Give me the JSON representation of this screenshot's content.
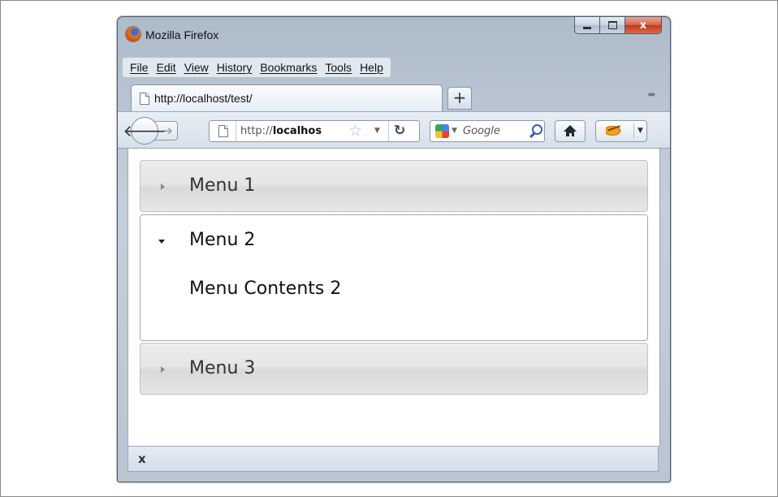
{
  "window": {
    "title": "Mozilla Firefox",
    "controls": {
      "minimize_icon": "minimize-icon",
      "maximize_icon": "maximize-icon",
      "close_label": "x"
    }
  },
  "menubar": {
    "items": [
      {
        "label": "File"
      },
      {
        "label": "Edit"
      },
      {
        "label": "View"
      },
      {
        "label": "History"
      },
      {
        "label": "Bookmarks"
      },
      {
        "label": "Tools"
      },
      {
        "label": "Help"
      }
    ]
  },
  "tabs": {
    "active_tab": {
      "label": "http://localhost/test/"
    },
    "new_tab_label": "+"
  },
  "navbar": {
    "url": {
      "prefix": "http://",
      "host": "localhos"
    },
    "search": {
      "placeholder": "Google"
    }
  },
  "accordion": {
    "items": [
      {
        "title": "Menu 1",
        "expanded": false
      },
      {
        "title": "Menu 2",
        "expanded": true,
        "content": "Menu Contents 2"
      },
      {
        "title": "Menu 3",
        "expanded": false
      }
    ]
  },
  "statusbar": {
    "close_label": "x"
  },
  "colors": {
    "header_bg": "#e5e5e5",
    "header_border": "#c2c2c2",
    "accent_search": "#2e5fb8"
  }
}
